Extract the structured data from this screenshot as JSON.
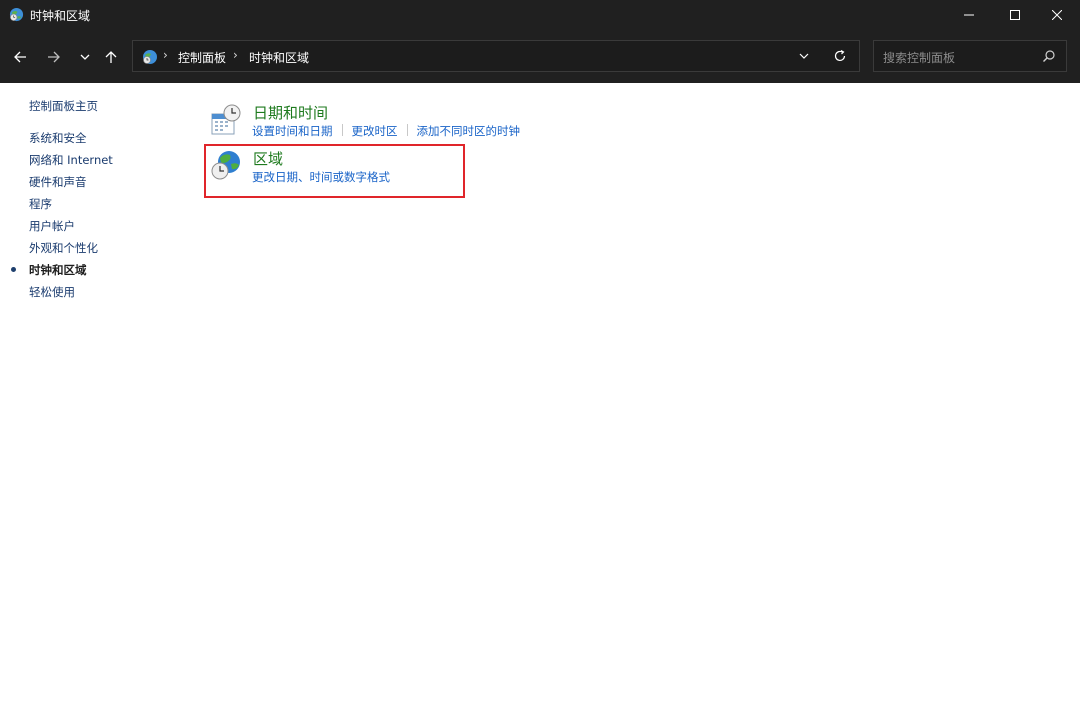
{
  "window": {
    "title": "时钟和区域"
  },
  "titlebar_buttons": {
    "minimize": "minimize-icon",
    "maximize": "maximize-icon",
    "close": "close-icon"
  },
  "address_bar": {
    "breadcrumbs": [
      "控制面板",
      "时钟和区域"
    ],
    "separator": "›"
  },
  "search": {
    "placeholder": "搜索控制面板"
  },
  "left_nav": {
    "home": "控制面板主页",
    "items": [
      "系统和安全",
      "网络和 Internet",
      "硬件和声音",
      "程序",
      "用户帐户",
      "外观和个性化",
      "时钟和区域",
      "轻松使用"
    ],
    "active": "时钟和区域"
  },
  "categories": [
    {
      "title": "日期和时间",
      "icon": "calendar-clock-icon",
      "links": [
        "设置时间和日期",
        "更改时区",
        "添加不同时区的时钟"
      ]
    },
    {
      "title": "区域",
      "icon": "globe-clock-icon",
      "links": [
        "更改日期、时间或数字格式"
      ]
    }
  ],
  "colors": {
    "titlebar": "#202020",
    "link": "#1a64c8",
    "category_title": "#1e7a1e",
    "highlight": "#e0252a"
  }
}
